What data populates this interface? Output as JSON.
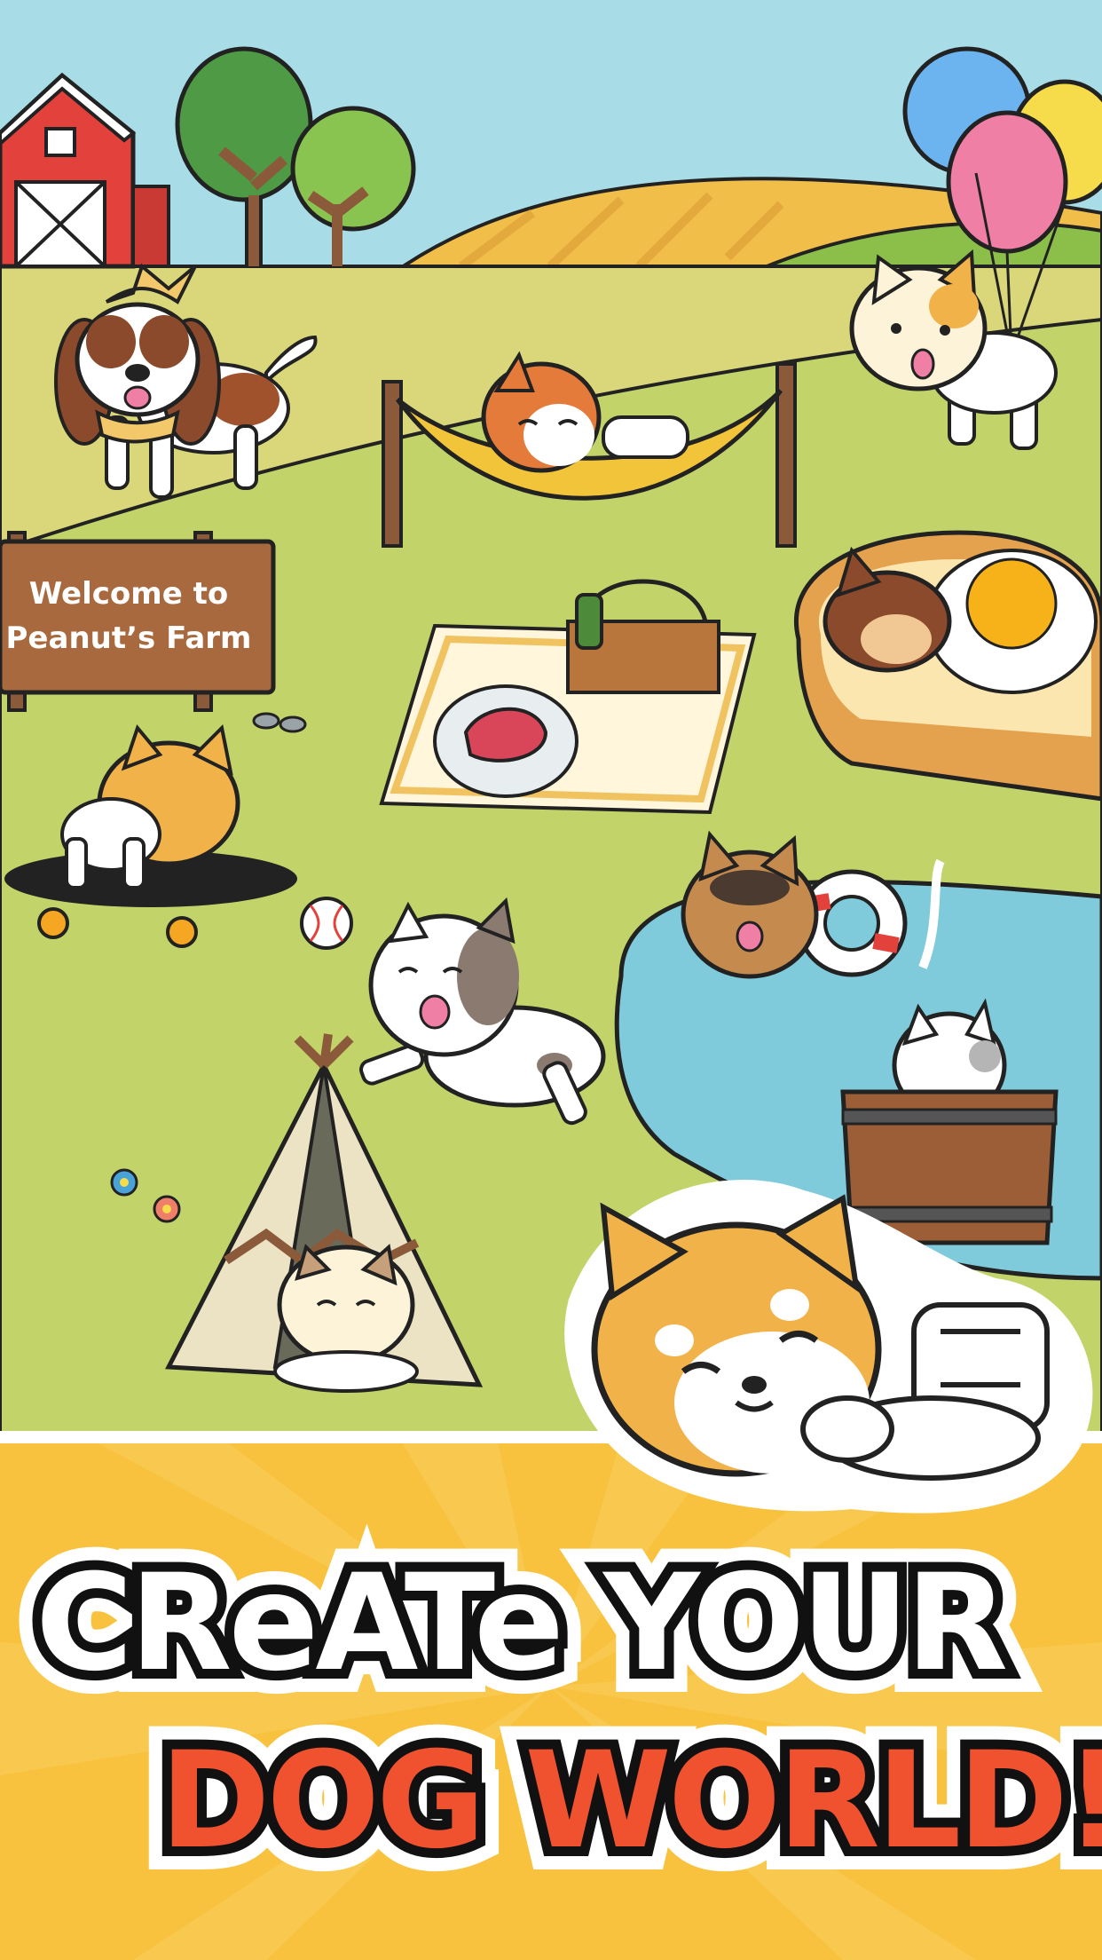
{
  "sign": {
    "line1": "Welcome to",
    "line2": "Peanut’s Farm"
  },
  "banner": {
    "line1": "CReATe YOUR",
    "line2": "DOG WORLD!"
  },
  "colors": {
    "sky": "#a8dde8",
    "grass": "#c2d36a",
    "grass_far": "#d9d77a",
    "pond": "#7fcbdb",
    "banner_bg": "#f8c23e",
    "banner_red": "#f0522f",
    "barn": "#e2423b"
  }
}
